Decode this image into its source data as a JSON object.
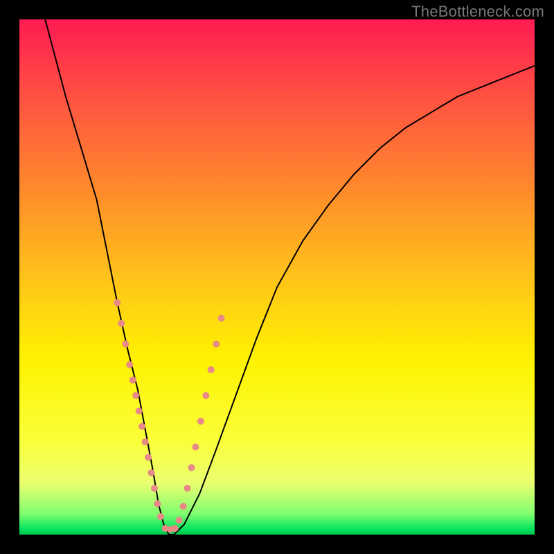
{
  "watermark": "TheBottleneck.com",
  "chart_data": {
    "type": "line",
    "title": "",
    "xlabel": "",
    "ylabel": "",
    "xlim": [
      0,
      100
    ],
    "ylim": [
      0,
      100
    ],
    "gradient_stops": [
      {
        "pos": 0.0,
        "color": "#ff1b52"
      },
      {
        "pos": 0.17,
        "color": "#ff5840"
      },
      {
        "pos": 0.33,
        "color": "#ff8a2b"
      },
      {
        "pos": 0.5,
        "color": "#ffc31a"
      },
      {
        "pos": 0.66,
        "color": "#fff200"
      },
      {
        "pos": 0.82,
        "color": "#f9ff3a"
      },
      {
        "pos": 0.9,
        "color": "#eaff70"
      },
      {
        "pos": 0.96,
        "color": "#7fff6f"
      },
      {
        "pos": 0.99,
        "color": "#00e35c"
      },
      {
        "pos": 1.0,
        "color": "#00c24d"
      }
    ],
    "series": [
      {
        "name": "curve",
        "stroke": "#000000",
        "stroke_width": 2,
        "x": [
          5,
          9,
          12,
          15,
          17,
          19,
          21,
          23,
          24.5,
          26,
          27,
          28,
          29,
          30,
          32,
          35,
          38,
          42,
          46,
          50,
          55,
          60,
          65,
          70,
          75,
          80,
          85,
          90,
          95,
          100
        ],
        "y": [
          100,
          85,
          75,
          65,
          55,
          45,
          36,
          28,
          20,
          12,
          6,
          2,
          0,
          0,
          2,
          8,
          16,
          27,
          38,
          48,
          57,
          64,
          70,
          75,
          79,
          82,
          85,
          87,
          89,
          91
        ]
      }
    ],
    "annotation_points": {
      "fill": "#e78a86",
      "radius": 5,
      "points": [
        {
          "x": 19.0,
          "y": 45
        },
        {
          "x": 19.8,
          "y": 41
        },
        {
          "x": 20.6,
          "y": 37
        },
        {
          "x": 21.4,
          "y": 33
        },
        {
          "x": 22.0,
          "y": 30
        },
        {
          "x": 22.6,
          "y": 27
        },
        {
          "x": 23.2,
          "y": 24
        },
        {
          "x": 23.8,
          "y": 21
        },
        {
          "x": 24.4,
          "y": 18
        },
        {
          "x": 25.0,
          "y": 15
        },
        {
          "x": 25.6,
          "y": 12
        },
        {
          "x": 26.2,
          "y": 9
        },
        {
          "x": 26.8,
          "y": 6
        },
        {
          "x": 27.4,
          "y": 3.5
        },
        {
          "x": 28.3,
          "y": 1.2
        },
        {
          "x": 29.3,
          "y": 1.0
        },
        {
          "x": 30.2,
          "y": 1.2
        },
        {
          "x": 31.0,
          "y": 2.8
        },
        {
          "x": 31.8,
          "y": 5.5
        },
        {
          "x": 32.6,
          "y": 9.0
        },
        {
          "x": 33.4,
          "y": 13
        },
        {
          "x": 34.2,
          "y": 17
        },
        {
          "x": 35.2,
          "y": 22
        },
        {
          "x": 36.2,
          "y": 27
        },
        {
          "x": 37.2,
          "y": 32
        },
        {
          "x": 38.2,
          "y": 37
        },
        {
          "x": 39.2,
          "y": 42
        }
      ]
    }
  }
}
